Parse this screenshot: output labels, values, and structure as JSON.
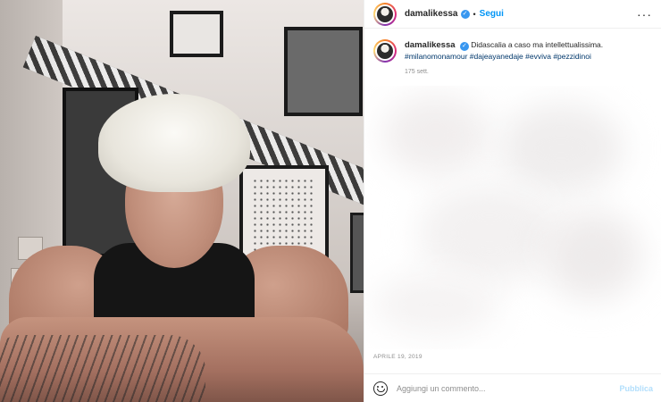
{
  "post": {
    "username": "damalikessa",
    "verified_icon": "verified-badge-icon",
    "separator": "•",
    "follow_label": "Segui",
    "more_label": "···"
  },
  "caption": {
    "username": "damalikessa",
    "text": "Didascalia a caso ma intellettualissima.",
    "hashtags": "#milanomonamour #dajeayanedaje #evviva #pezzidinoi",
    "time": "175 sett."
  },
  "footer": {
    "date": "APRILE 19, 2019"
  },
  "comment": {
    "placeholder": "Aggiungi un commento...",
    "publish_label": "Pubblica",
    "emoji_icon": "emoji-smile-icon"
  },
  "colors": {
    "accent": "#0095f6",
    "publish_disabled": "#b2dffc",
    "verified": "#3897f0",
    "muted": "#8e8e8e"
  }
}
